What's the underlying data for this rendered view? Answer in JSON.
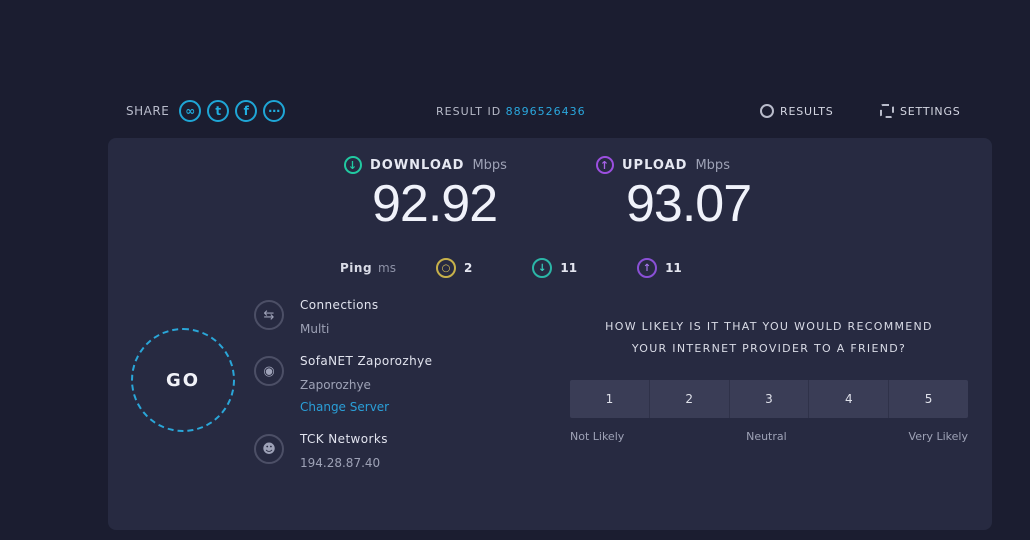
{
  "header": {
    "share_label": "SHARE",
    "share_icons": [
      "link-icon",
      "twitter-icon",
      "facebook-icon",
      "more-icon"
    ],
    "result_id_label": "RESULT ID",
    "result_id_value": "8896526436",
    "results_label": "RESULTS",
    "settings_label": "SETTINGS"
  },
  "download": {
    "label": "DOWNLOAD",
    "unit": "Mbps",
    "value": "92.92",
    "color": "#21c9a1"
  },
  "upload": {
    "label": "UPLOAD",
    "unit": "Mbps",
    "value": "93.07",
    "color": "#9c4fe0"
  },
  "ping": {
    "label": "Ping",
    "unit": "ms",
    "idle": "2",
    "download": "11",
    "upload": "11"
  },
  "go_label": "GO",
  "connections": {
    "label": "Connections",
    "value": "Multi",
    "server_name": "SofaNET Zaporozhye",
    "server_location": "Zaporozhye",
    "change_server": "Change Server",
    "isp_name": "TCK Networks",
    "isp_ip": "194.28.87.40"
  },
  "survey": {
    "question_line1": "HOW LIKELY IS IT THAT YOU WOULD RECOMMEND",
    "question_line2": "YOUR INTERNET PROVIDER TO A FRIEND?",
    "options": [
      "1",
      "2",
      "3",
      "4",
      "5"
    ],
    "label_left": "Not Likely",
    "label_mid": "Neutral",
    "label_right": "Very Likely"
  },
  "colors": {
    "accent": "#2aa7dd",
    "background": "#1b1d30",
    "panel": "#272a41"
  }
}
